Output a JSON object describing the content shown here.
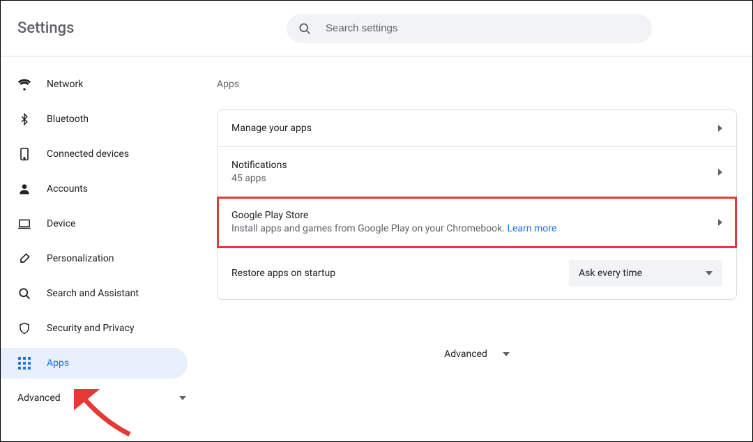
{
  "header": {
    "title": "Settings"
  },
  "search": {
    "placeholder": "Search settings"
  },
  "sidebar": {
    "items": [
      {
        "label": "Network",
        "icon": "wifi"
      },
      {
        "label": "Bluetooth",
        "icon": "bluetooth"
      },
      {
        "label": "Connected devices",
        "icon": "phone"
      },
      {
        "label": "Accounts",
        "icon": "person"
      },
      {
        "label": "Device",
        "icon": "laptop"
      },
      {
        "label": "Personalization",
        "icon": "brush"
      },
      {
        "label": "Search and Assistant",
        "icon": "search"
      },
      {
        "label": "Security and Privacy",
        "icon": "shield"
      },
      {
        "label": "Apps",
        "icon": "apps"
      }
    ],
    "advanced": "Advanced"
  },
  "main": {
    "section_title": "Apps",
    "rows": [
      {
        "title": "Manage your apps"
      },
      {
        "title": "Notifications",
        "sub": "45 apps"
      },
      {
        "title": "Google Play Store",
        "sub": "Install apps and games from Google Play on your Chromebook. ",
        "link": "Learn more"
      },
      {
        "title": "Restore apps on startup",
        "select": "Ask every time"
      }
    ],
    "advanced": "Advanced"
  }
}
